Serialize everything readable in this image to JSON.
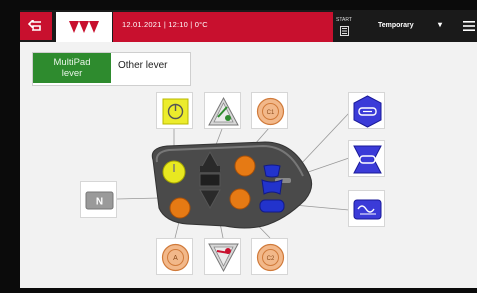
{
  "header": {
    "status_text": "12.01.2021 | 12:10 | 0°C",
    "start_label": "START",
    "profile_value": "Temporary",
    "profile_caret": "▾"
  },
  "lever_toggle": {
    "multipad_line1": "MultiPad",
    "multipad_line2": "lever",
    "other_label": "Other lever"
  },
  "buttons": {
    "neutral_label": "N",
    "a_label": "A",
    "c1_label": "C1",
    "c2_label": "C2"
  },
  "colors": {
    "brand_red": "#c8102e",
    "active_green": "#2e8b2e",
    "button_yellow": "#e8e820",
    "button_orange": "#e67a14",
    "button_blue": "#2233cc"
  }
}
